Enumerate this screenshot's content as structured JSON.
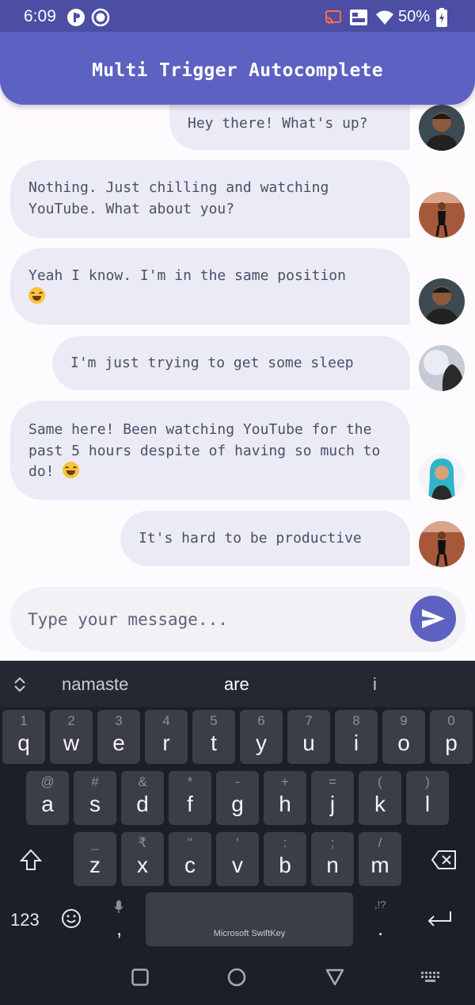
{
  "status_bar": {
    "time": "6:09",
    "battery": "50%"
  },
  "app": {
    "title": "Multi Trigger Autocomplete"
  },
  "messages": [
    {
      "text": "Hey there! What's up?"
    },
    {
      "text": "Nothing. Just chilling and watching YouTube. What about you?"
    },
    {
      "text": "Yeah I know. I'm in the same position"
    },
    {
      "text": "I'm just trying to get some sleep"
    },
    {
      "text": "Same here! Been watching YouTube for the past 5 hours despite of having so much to do!"
    },
    {
      "text": "It's hard to be productive"
    }
  ],
  "composer": {
    "placeholder": "Type your message..."
  },
  "keyboard": {
    "suggestions": [
      "namaste",
      "are",
      "i"
    ],
    "row1": [
      [
        "1",
        "q"
      ],
      [
        "2",
        "w"
      ],
      [
        "3",
        "e"
      ],
      [
        "4",
        "r"
      ],
      [
        "5",
        "t"
      ],
      [
        "6",
        "y"
      ],
      [
        "7",
        "u"
      ],
      [
        "8",
        "i"
      ],
      [
        "9",
        "o"
      ],
      [
        "0",
        "p"
      ]
    ],
    "row2": [
      [
        "@",
        "a"
      ],
      [
        "#",
        "s"
      ],
      [
        "&",
        "d"
      ],
      [
        "*",
        "f"
      ],
      [
        "-",
        "g"
      ],
      [
        "+",
        "h"
      ],
      [
        "=",
        "j"
      ],
      [
        "(",
        "k"
      ],
      [
        ")",
        "l"
      ]
    ],
    "row3": [
      [
        "_",
        "z"
      ],
      [
        "₹",
        "x"
      ],
      [
        "\"",
        "c"
      ],
      [
        "'",
        "v"
      ],
      [
        ":",
        "b"
      ],
      [
        ";",
        "n"
      ],
      [
        "/",
        "m"
      ]
    ],
    "numbers_key": "123",
    "comma_key": ",",
    "period_key": ".",
    "period_hint": ",!?",
    "space_label": "Microsoft SwiftKey"
  },
  "colors": {
    "primary": "#5c61c2",
    "status_bar": "#4b4ea3",
    "bubble": "#ebebf6",
    "keyboard": "#1c1f29"
  }
}
